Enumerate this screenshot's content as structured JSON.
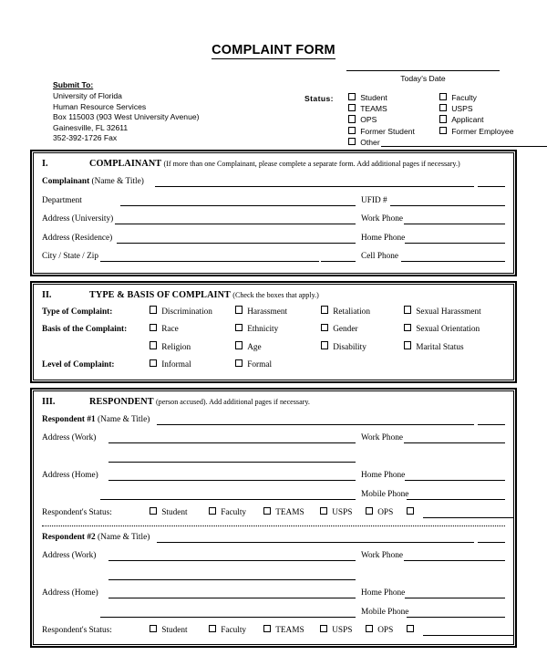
{
  "document": {
    "title": "COMPLAINT FORM"
  },
  "header": {
    "submit_to_label": "Submit To:",
    "address_lines": [
      "University of Florida",
      "Human Resource Services",
      "Box 115003 (903 West University Avenue)",
      "Gainesville, FL  32611",
      "352-392-1726 Fax"
    ],
    "date_label": "Today's Date",
    "status_label": "Status:",
    "status_rows": [
      {
        "left": "Student",
        "right": "Faculty"
      },
      {
        "left": "TEAMS",
        "right": "USPS"
      },
      {
        "left": "OPS",
        "right": "Applicant"
      },
      {
        "left": "Former Student",
        "right": "Former Employee"
      }
    ],
    "status_other": "Other"
  },
  "section_1": {
    "number": "I.",
    "title": "COMPLAINANT",
    "note": "(If more than one Complainant, please complete a separate form.  Add additional pages if necessary.)",
    "complainant_label": "Complainant",
    "complainant_note": "(Name & Title)",
    "rows": [
      {
        "left": "Department",
        "right": "UFID #"
      },
      {
        "left": "Address (University)",
        "right": "Work Phone"
      },
      {
        "left": "Address (Residence)",
        "right": "Home Phone"
      },
      {
        "left": "City / State / Zip",
        "right": "Cell Phone"
      }
    ]
  },
  "section_2": {
    "number": "II.",
    "title": "TYPE & BASIS OF COMPLAINT",
    "note": "(Check the boxes that apply.)",
    "rows": [
      {
        "label": "Type of Complaint:",
        "options": [
          "Discrimination",
          "Harassment",
          "Retaliation",
          "Sexual Harassment"
        ]
      },
      {
        "label": "Basis of the Complaint:",
        "options": [
          "Race",
          "Ethnicity",
          "Gender",
          "Sexual Orientation"
        ]
      },
      {
        "label": "",
        "options": [
          "Religion",
          "Age",
          "Disability",
          "Marital Status"
        ]
      },
      {
        "label": "Level of Complaint:",
        "options": [
          "Informal",
          "Formal"
        ]
      }
    ]
  },
  "section_3": {
    "number": "III.",
    "title": "RESPONDENT",
    "note": "(person accused).   Add additional pages if necessary.",
    "name_note": "(Name & Title)",
    "status_label": "Respondent's Status:",
    "status_options": [
      "Student",
      "Faculty",
      "TEAMS",
      "USPS",
      "OPS"
    ],
    "respondents": [
      {
        "name_label": "Respondent #1",
        "rows": [
          {
            "left": "Address (Work)",
            "right": "Work Phone"
          },
          {
            "left": "",
            "right": ""
          },
          {
            "left": "Address (Home)",
            "right": "Home Phone"
          },
          {
            "left": "",
            "right": "Mobile Phone"
          }
        ]
      },
      {
        "name_label": "Respondent #2",
        "rows": [
          {
            "left": "Address (Work)",
            "right": "Work Phone"
          },
          {
            "left": "",
            "right": ""
          },
          {
            "left": "Address (Home)",
            "right": "Home Phone"
          },
          {
            "left": "",
            "right": "Mobile Phone"
          }
        ]
      }
    ]
  }
}
